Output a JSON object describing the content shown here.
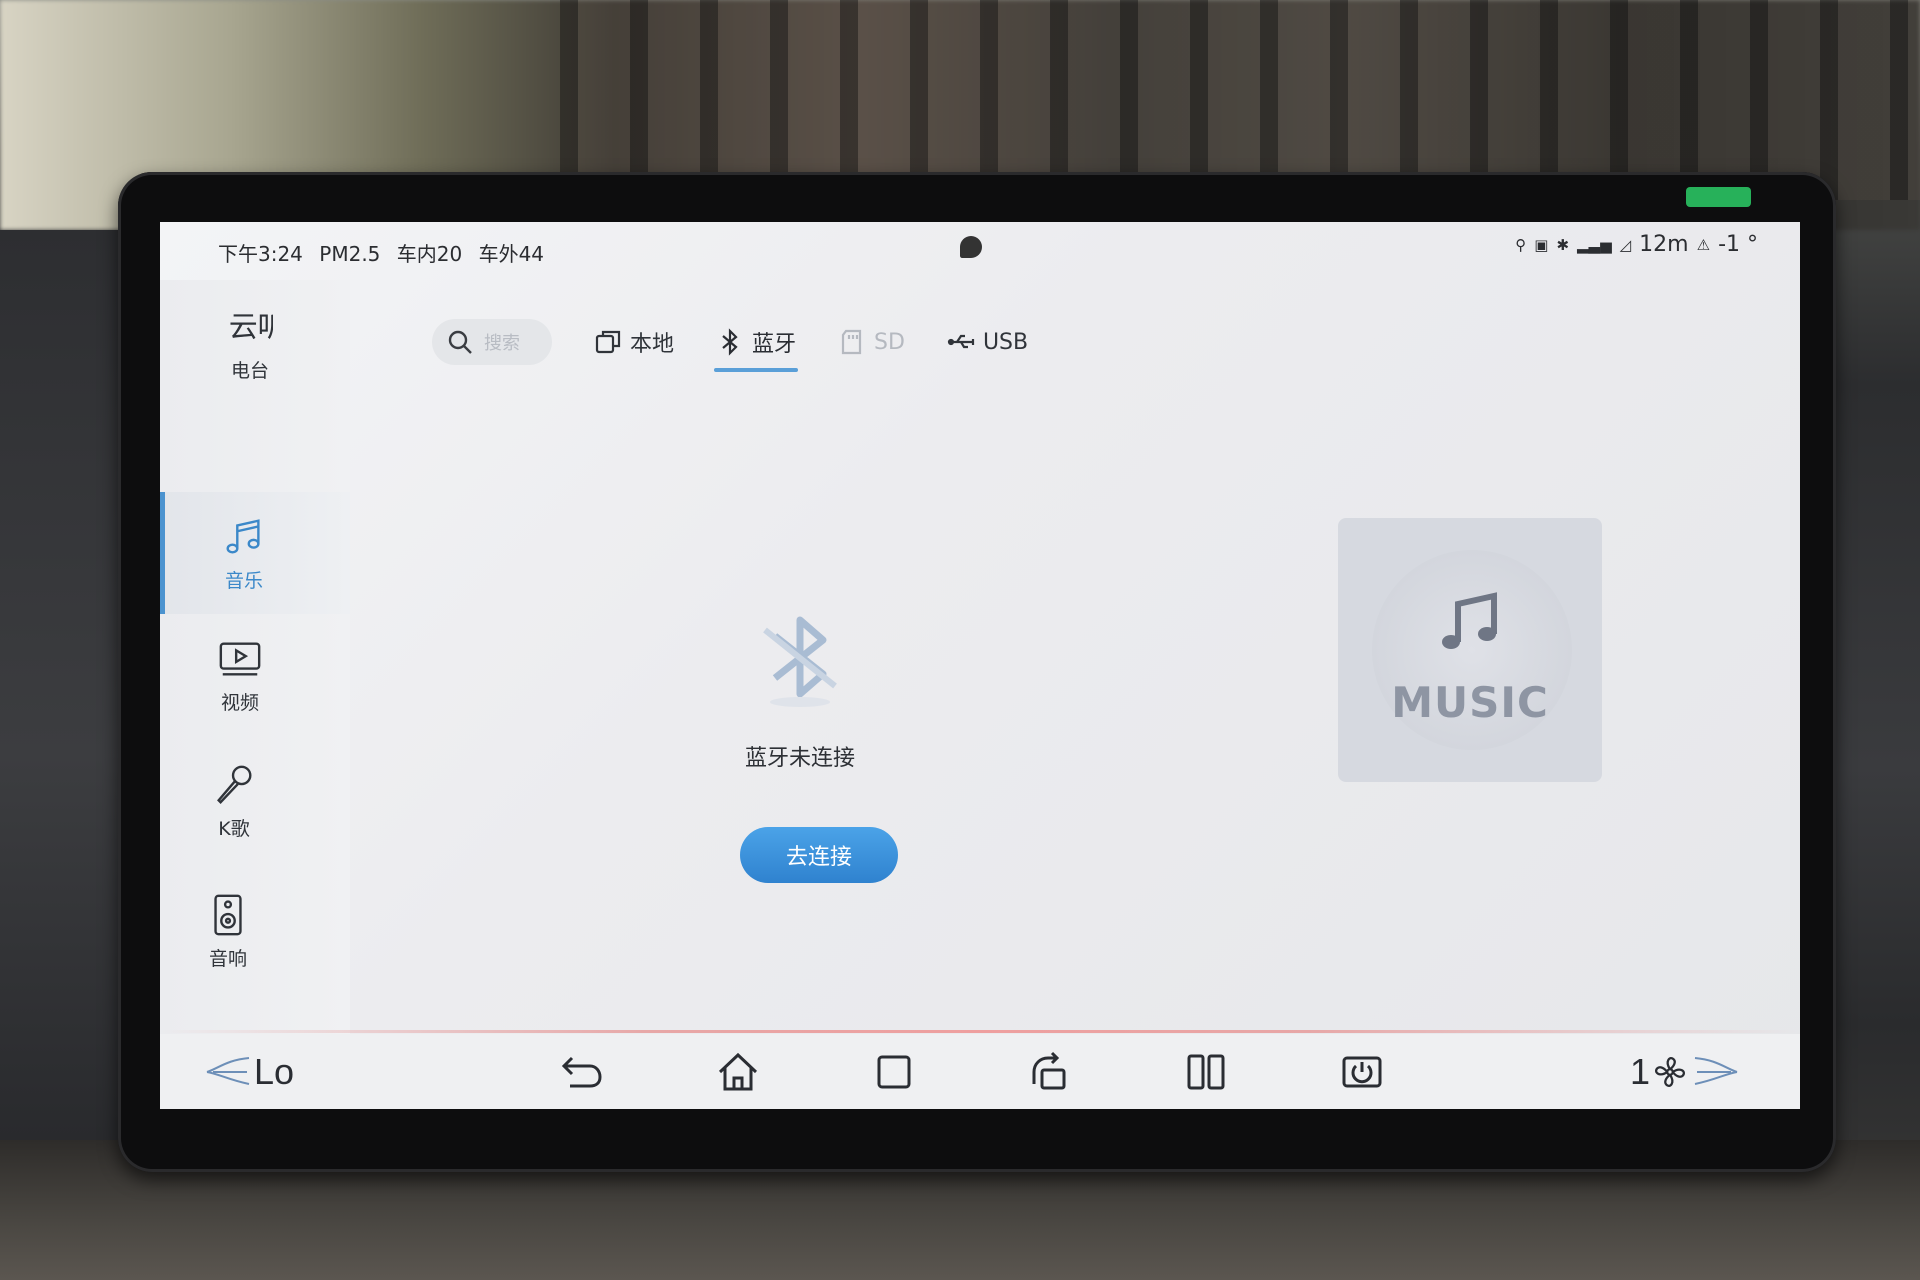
{
  "status_bar": {
    "time": "下午3:24",
    "pm25": "PM2.5",
    "inside": "车内20",
    "outside": "车外44",
    "signal_label": "12m",
    "temp_right": "-1 °"
  },
  "sidenav": {
    "items": [
      {
        "label": "电台",
        "icon": "radio-icon"
      },
      {
        "label": "音乐",
        "icon": "music-note-icon",
        "active": true
      },
      {
        "label": "视频",
        "icon": "video-icon"
      },
      {
        "label": "K歌",
        "icon": "microphone-icon"
      },
      {
        "label": "音响",
        "icon": "speaker-icon"
      }
    ]
  },
  "tabs": {
    "search_placeholder": "搜索",
    "items": [
      {
        "label": "本地",
        "icon": "local-folder-icon"
      },
      {
        "label": "蓝牙",
        "icon": "bluetooth-icon",
        "active": true
      },
      {
        "label": "SD",
        "icon": "sd-card-icon",
        "disabled": true
      },
      {
        "label": "USB",
        "icon": "usb-icon"
      }
    ]
  },
  "main": {
    "bluetooth_status": "蓝牙未连接",
    "connect_button": "去连接",
    "album_placeholder": "MUSIC"
  },
  "bottom_bar": {
    "left_temp": "Lo",
    "right_fan_level": "1",
    "icons": [
      "back-icon",
      "home-icon",
      "recent-apps-icon",
      "screen-rotate-icon",
      "split-screen-icon",
      "power-icon"
    ]
  },
  "colors": {
    "accent": "#3b88c9",
    "button": "#2f82cf",
    "screen_bg": "#eceef0"
  }
}
